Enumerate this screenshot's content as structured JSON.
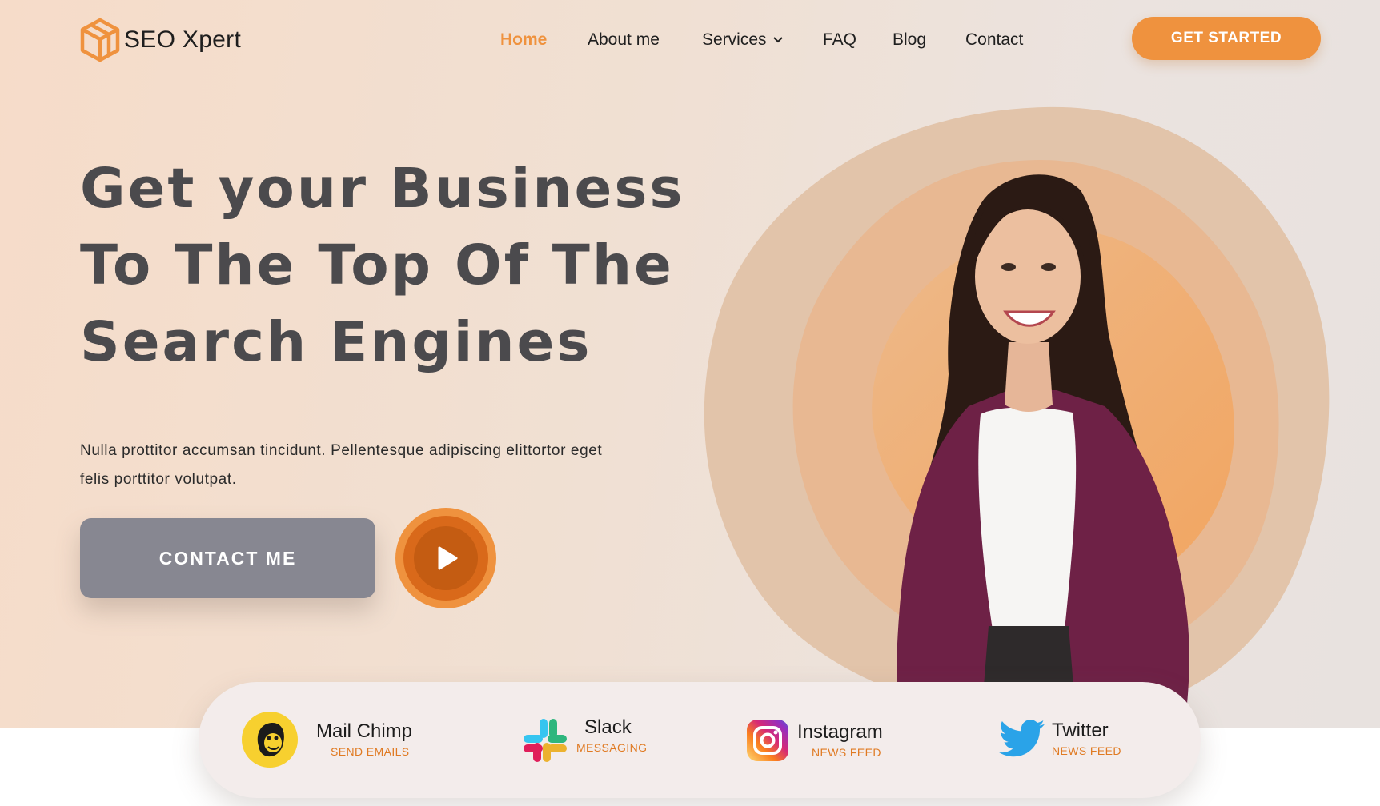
{
  "brand": {
    "name": "SEO Xpert",
    "accent_color": "#ef923e",
    "logo_icon": "isometric-cube-logo"
  },
  "nav": {
    "items": [
      {
        "label": "Home",
        "active": true
      },
      {
        "label": "About me",
        "active": false
      },
      {
        "label": "Services",
        "active": false,
        "icon": "chevron-down-icon"
      },
      {
        "label": "FAQ",
        "active": false
      },
      {
        "label": "Blog",
        "active": false
      },
      {
        "label": "Contact",
        "active": false
      }
    ],
    "cta_label": "GET STARTED"
  },
  "hero": {
    "headline_lines": [
      "Get your Business",
      "To The Top Of The",
      "Search Engines"
    ],
    "subtext_lines": [
      "Nulla prottitor accumsan tincidunt. Pellentesque adipiscing elittortor eget",
      "felis porttitor volutpat."
    ],
    "contact_label": "CONTACT ME",
    "play_icon": "play-icon",
    "image": "smiling-woman-portrait-on-layered-orange-blob"
  },
  "partners": [
    {
      "name": "Mail Chimp",
      "tagline": "SEND EMAILS",
      "icon": "mailchimp-icon"
    },
    {
      "name": "Slack",
      "tagline": "MESSAGING",
      "icon": "slack-icon"
    },
    {
      "name": "Instagram",
      "tagline": "NEWS FEED",
      "icon": "instagram-icon"
    },
    {
      "name": "Twitter",
      "tagline": "NEWS FEED",
      "icon": "twitter-icon"
    }
  ]
}
